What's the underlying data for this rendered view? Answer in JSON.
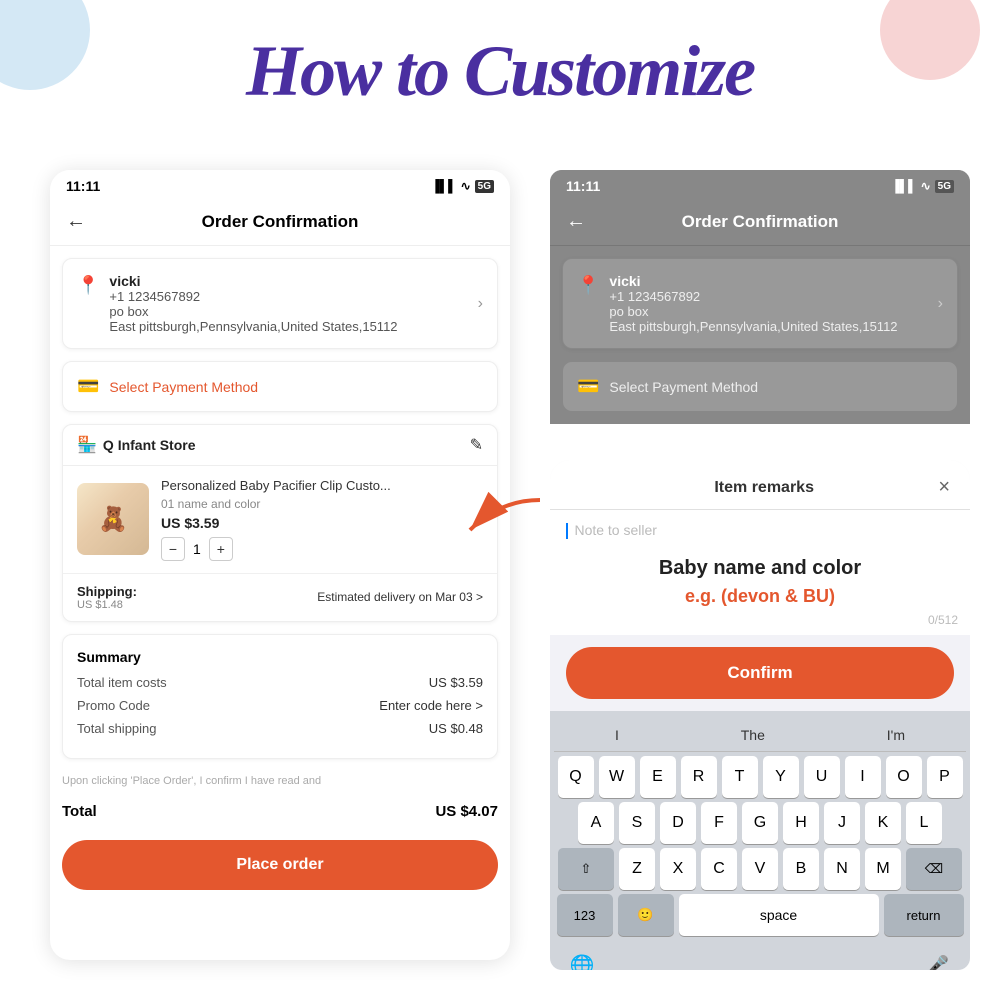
{
  "page": {
    "title": "How to Customize",
    "bg_circle_colors": [
      "#d4e8f5",
      "#f7d4d4"
    ]
  },
  "left_panel": {
    "status_bar": {
      "time": "11:11",
      "icons": "📶 WiFi 5G"
    },
    "nav": {
      "back_icon": "←",
      "title": "Order Confirmation"
    },
    "address": {
      "name": "vicki",
      "phone": "+1 1234567892",
      "street": "po box",
      "city": "East pittsburgh,Pennsylvania,United States,15112"
    },
    "payment": {
      "label": "Select Payment Method"
    },
    "store": {
      "name": "Q Infant Store",
      "note_icon": "✎"
    },
    "product": {
      "name": "Personalized Baby Pacifier Clip Custo...",
      "variant": "01 name and color",
      "price": "US $3.59",
      "qty": "1"
    },
    "shipping": {
      "label": "Shipping:",
      "cost": "US $1.48",
      "estimated": "Estimated delivery on Mar 03 >"
    },
    "summary": {
      "title": "Summary",
      "item_cost_label": "Total item costs",
      "item_cost_value": "US $3.59",
      "promo_label": "Promo Code",
      "promo_value": "Enter code here >",
      "shipping_label": "Total shipping",
      "shipping_value": "US $0.48"
    },
    "disclaimer": "Upon clicking 'Place Order', I confirm I have read and",
    "total_label": "Total",
    "total_value": "US $4.07",
    "place_order": "Place order"
  },
  "right_panel": {
    "status_bar": {
      "time": "11:11"
    },
    "nav": {
      "back_icon": "←",
      "title": "Order Confirmation"
    },
    "address": {
      "name": "vicki",
      "phone": "+1 1234567892",
      "street": "po box",
      "city": "East pittsburgh,Pennsylvania,United States,15112"
    },
    "payment_label": "Select Payment Method",
    "modal": {
      "title": "Item remarks",
      "close": "×",
      "placeholder": "Note to seller",
      "char_count": "0/512",
      "instruction_main": "Baby name and color",
      "instruction_eg": "e.g.\n(devon & BU)",
      "confirm_label": "Confirm"
    },
    "keyboard": {
      "suggestions": [
        "I",
        "The",
        "I'm"
      ],
      "row1": [
        "Q",
        "W",
        "E",
        "R",
        "T",
        "Y",
        "U",
        "I",
        "O",
        "P"
      ],
      "row2": [
        "A",
        "S",
        "D",
        "F",
        "G",
        "H",
        "J",
        "K",
        "L"
      ],
      "row3": [
        "Z",
        "X",
        "C",
        "V",
        "B",
        "N",
        "M"
      ],
      "special_shift": "⇧",
      "special_delete": "⌫",
      "special_123": "123",
      "emoji": "🙂",
      "space": "space",
      "return": "return",
      "globe": "🌐",
      "mic": "🎤"
    }
  }
}
